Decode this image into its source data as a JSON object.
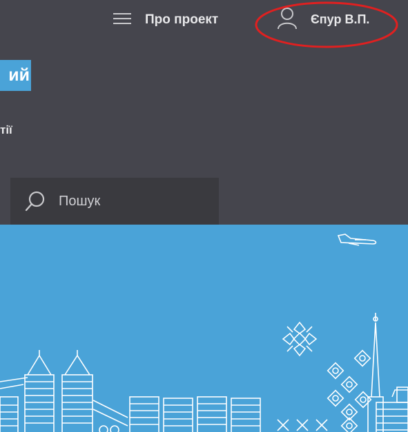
{
  "header": {
    "menu_label": "Про проект",
    "user_name": "Єпур В.П."
  },
  "site": {
    "title_fragment": "ий",
    "subtitle_fragment": "тії"
  },
  "search": {
    "placeholder": "Пошук"
  },
  "colors": {
    "header_bg": "#45454d",
    "search_bg": "#3a3a3f",
    "accent": "#4aa3d8",
    "highlight": "#e02020"
  },
  "icons": [
    "menu-icon",
    "user-icon",
    "search-icon",
    "airplane-icon",
    "snowflake-ornament-icon"
  ]
}
